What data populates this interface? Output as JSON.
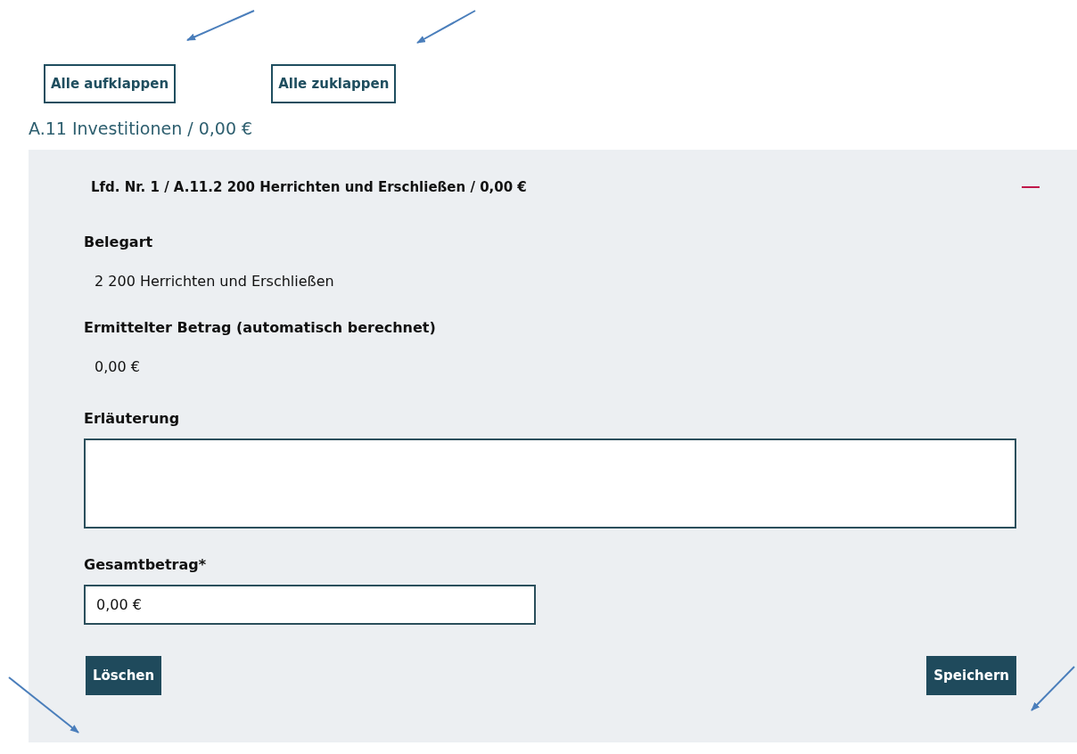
{
  "toolbar": {
    "buttons": [
      "Alle aufklappen",
      "Alle zuklappen"
    ]
  },
  "section_title": "A.11 Investitionen / 0,00 €",
  "entry": {
    "title": "Lfd. Nr. 1 / A.11.2 200 Herrichten und Erschließen / 0,00 €",
    "expanded": true,
    "fields": [
      {
        "kind": "readonly",
        "label": "Belegart",
        "value": "2 200 Herrichten und Erschließen"
      },
      {
        "kind": "readonly",
        "label": "Ermittelter Betrag (automatisch berechnet)",
        "value": "0,00 €"
      },
      {
        "kind": "textarea",
        "label": "Erläuterung"
      },
      {
        "kind": "input",
        "label": "Gesamtbetrag*",
        "value": "0,00 €"
      }
    ],
    "actions": [
      "Löschen",
      "Speichern"
    ]
  }
}
